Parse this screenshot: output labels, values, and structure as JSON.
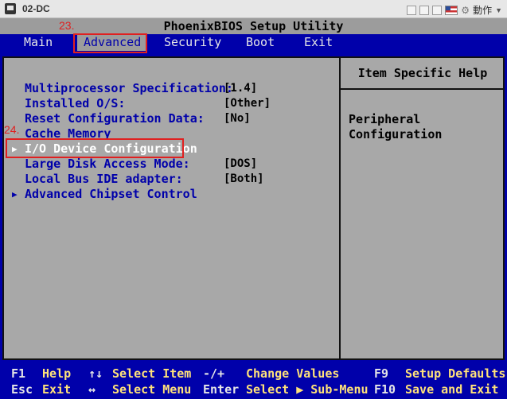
{
  "window": {
    "title": "02-DC",
    "action_label": "動作"
  },
  "bios_title": "PhoenixBIOS Setup Utility",
  "menu": [
    "Main",
    "Advanced",
    "Security",
    "Boot",
    "Exit"
  ],
  "settings": [
    {
      "label": "Multiprocessor Specification:",
      "value": "[1.4]"
    },
    {
      "label": "Installed O/S:",
      "value": "[Other]"
    },
    {
      "label": "Reset Configuration Data:",
      "value": "[No]"
    },
    {
      "label": "Cache Memory",
      "value": ""
    },
    {
      "label": "I/O Device Configuration",
      "value": ""
    },
    {
      "label": "Large Disk Access Mode:",
      "value": "[DOS]"
    },
    {
      "label": "Local Bus IDE adapter:",
      "value": "[Both]"
    },
    {
      "label": "Advanced Chipset Control",
      "value": ""
    }
  ],
  "help": {
    "title": "Item Specific Help",
    "text": "Peripheral\nConfiguration"
  },
  "annotations": {
    "menu_step": "23.",
    "item_step": "24."
  },
  "footer": {
    "row1": [
      {
        "key": "F1",
        "desc": "Help"
      },
      {
        "key": "↑↓",
        "desc": "Select Item"
      },
      {
        "key": "-/+",
        "desc": "Change Values"
      },
      {
        "key": "F9",
        "desc": "Setup Defaults"
      }
    ],
    "row2": [
      {
        "key": "Esc",
        "desc": "Exit"
      },
      {
        "key": "↔",
        "desc": "Select Menu"
      },
      {
        "key": "Enter",
        "desc": "Select ▶ Sub-Menu"
      },
      {
        "key": "F10",
        "desc": "Save and Exit"
      }
    ]
  },
  "colors": {
    "bios_blue": "#0000aa",
    "panel_gray": "#a8a8a8",
    "highlight_red": "#e02020",
    "footer_desc": "#ffe27a"
  }
}
